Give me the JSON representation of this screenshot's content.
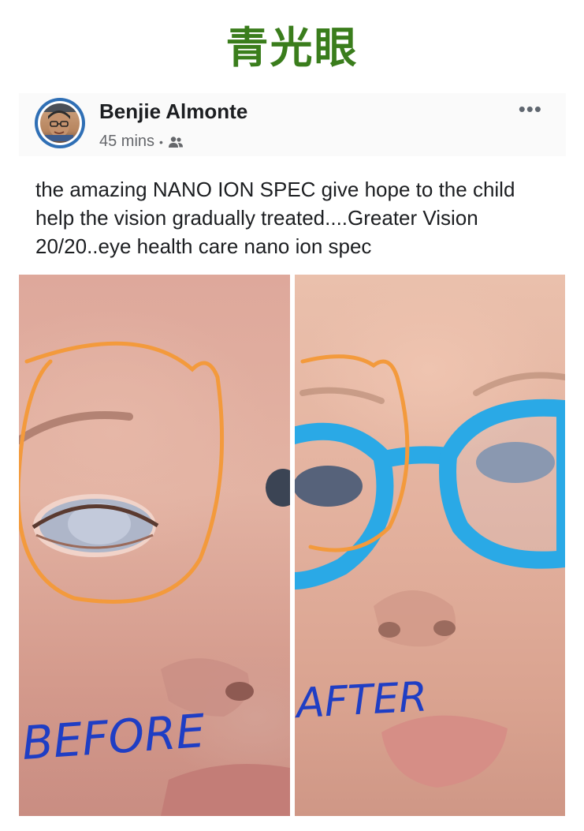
{
  "page_title": "青光眼",
  "post": {
    "author": "Benjie Almonte",
    "time": "45 mins",
    "separator": "•",
    "audience_icon": "friends-icon",
    "more_icon": "•••",
    "text": "the amazing NANO ION SPEC give hope to the child help the vision gradually treated....Greater Vision 20/20..eye health care nano ion spec"
  },
  "images": {
    "before_label": "BEFORE",
    "after_label": "AFTER"
  },
  "colors": {
    "title": "#3a7d1c",
    "annotation_circle": "#f39a3c",
    "annotation_text": "#1f3ec4",
    "glasses": "#2aa9e6"
  }
}
